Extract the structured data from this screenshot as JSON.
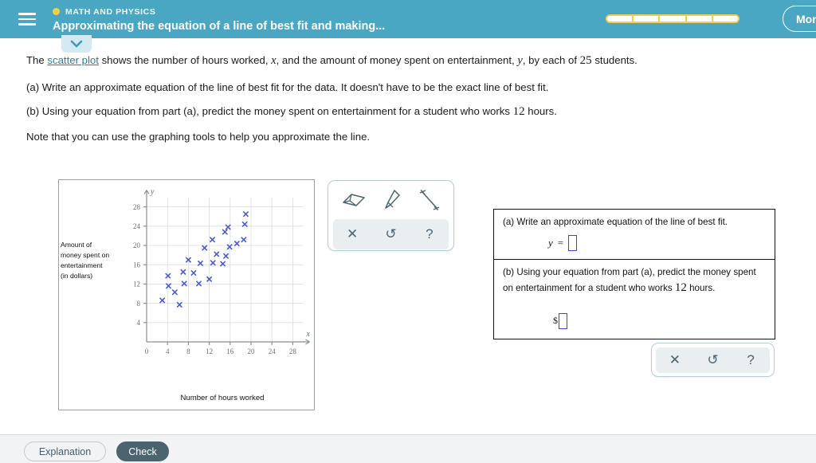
{
  "header": {
    "menu_icon": "hamburger-icon",
    "course_name": "MATH AND PHYSICS",
    "lesson_title": "Approximating the equation of a line of best fit and making...",
    "progress_segments": 5,
    "progress_filled": 0,
    "user_button_label": "Morg",
    "accent_color": "#4aa7c3",
    "progress_color": "#f2d049",
    "chevron_icon": "chevron-down-icon"
  },
  "question": {
    "intro_parts": {
      "p1": "The ",
      "link": "scatter plot",
      "p2": " shows the number of hours worked, ",
      "var_x": "x",
      "p3": ", and the amount of money spent on entertainment, ",
      "var_y": "y",
      "p4": ", by each of ",
      "count": "25",
      "p5": " students."
    },
    "part_a": "(a) Write an approximate equation of the line of best fit for the data. It doesn't have to be the exact line of best fit.",
    "part_b_parts": {
      "t1": "(b) Using your equation from part (a), predict the money spent on entertainment for a student who works ",
      "hours": "12",
      "t2": " hours."
    },
    "note": "Note that you can use the graphing tools to help you approximate the line."
  },
  "chart_data": {
    "type": "scatter",
    "title": "",
    "xlabel": "Number of hours worked",
    "ylabel": "Amount of money spent on entertainment (in dollars)",
    "ylabel_lines": [
      "Amount of",
      "money spent on",
      "entertainment",
      "(in dollars)"
    ],
    "x_axis_name": "x",
    "y_axis_name": "y",
    "xlim": [
      0,
      30
    ],
    "ylim": [
      0,
      30
    ],
    "xticks": [
      0,
      4,
      8,
      12,
      16,
      20,
      24,
      28
    ],
    "yticks": [
      4,
      8,
      12,
      16,
      20,
      24,
      28
    ],
    "grid": true,
    "marker": "x",
    "marker_color": "#4a5ad4",
    "n_points": 25,
    "points": [
      {
        "x": 3.0,
        "y": 8.6
      },
      {
        "x": 4.1,
        "y": 13.7
      },
      {
        "x": 4.2,
        "y": 11.6
      },
      {
        "x": 5.4,
        "y": 10.3
      },
      {
        "x": 6.3,
        "y": 7.7
      },
      {
        "x": 7.0,
        "y": 14.5
      },
      {
        "x": 7.2,
        "y": 12.1
      },
      {
        "x": 8.0,
        "y": 17.0
      },
      {
        "x": 9.0,
        "y": 14.3
      },
      {
        "x": 10.0,
        "y": 12.1
      },
      {
        "x": 10.3,
        "y": 16.3
      },
      {
        "x": 11.1,
        "y": 19.5
      },
      {
        "x": 12.0,
        "y": 13.0
      },
      {
        "x": 12.6,
        "y": 21.2
      },
      {
        "x": 12.7,
        "y": 16.4
      },
      {
        "x": 13.4,
        "y": 18.2
      },
      {
        "x": 14.6,
        "y": 16.2
      },
      {
        "x": 15.0,
        "y": 22.8
      },
      {
        "x": 15.2,
        "y": 17.8
      },
      {
        "x": 15.6,
        "y": 23.8
      },
      {
        "x": 15.9,
        "y": 19.7
      },
      {
        "x": 17.3,
        "y": 20.4
      },
      {
        "x": 18.6,
        "y": 21.2
      },
      {
        "x": 18.8,
        "y": 24.4
      },
      {
        "x": 19.0,
        "y": 26.5
      }
    ]
  },
  "toolbar": {
    "eraser_icon": "eraser-icon",
    "pencil_icon": "pencil-icon",
    "line_icon": "line-segment-icon",
    "clear_label": "✕",
    "undo_label": "↺",
    "help_label": "?",
    "clear_name": "clear-button",
    "undo_name": "undo-button",
    "help_name": "help-button"
  },
  "toolbar_secondary": {
    "clear_label": "✕",
    "undo_label": "↺",
    "help_label": "?"
  },
  "answers": {
    "part_a_prompt": "(a) Write an approximate equation of the line of best fit.",
    "part_a_lhs": "y",
    "part_a_equals": "=",
    "part_a_value": "",
    "part_b_prompt_1": "(b) Using your equation from part (a), predict the money spent",
    "part_b_prompt_2_pre": "on entertainment for a student who works ",
    "part_b_hours": "12",
    "part_b_prompt_2_post": " hours.",
    "part_b_currency": "$",
    "part_b_value": ""
  },
  "footer": {
    "explanation_label": "Explanation",
    "check_label": "Check"
  }
}
